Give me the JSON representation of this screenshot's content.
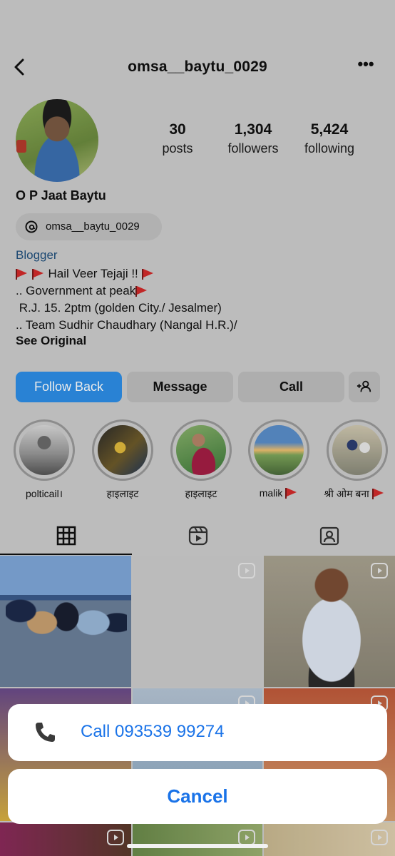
{
  "header": {
    "username": "omsa__baytu_0029"
  },
  "profile": {
    "stats": [
      {
        "value": "30",
        "label": "posts"
      },
      {
        "value": "1,304",
        "label": "followers"
      },
      {
        "value": "5,424",
        "label": "following"
      }
    ],
    "full_name": "O P Jaat Baytu",
    "threads_handle": "omsa__baytu_0029",
    "category": "Blogger",
    "bio": {
      "line1": "Hail Veer Tejaji !!",
      "line2": ".. Government at peak",
      "line3": " R.J. 15. 2ptm (golden City./ Jesalmer)",
      "line4": ".. Team Sudhir Chaudhary (Nangal H.R.)/"
    },
    "see_original": "See Original"
  },
  "actions": {
    "follow_back": "Follow Back",
    "message": "Message",
    "call": "Call"
  },
  "highlights": [
    {
      "label": "polticail।"
    },
    {
      "label": "हाइलाइट"
    },
    {
      "label": "हाइलाइट"
    },
    {
      "label": "malik"
    },
    {
      "label": "श्री ओम बना"
    }
  ],
  "action_sheet": {
    "call_option": "Call 093539 99274",
    "cancel": "Cancel"
  },
  "icons": {
    "back": "chevron-left-icon",
    "more": "more-horizontal-icon",
    "threads": "threads-icon",
    "add_person": "add-person-icon",
    "grid": "grid-icon",
    "reels": "reels-icon",
    "tagged": "tagged-icon",
    "phone": "phone-icon",
    "flag": "red-flag-emoji"
  },
  "colors": {
    "accent": "#2d8ee6",
    "sheet_link": "#1a73e8",
    "background": "#cccccc"
  }
}
